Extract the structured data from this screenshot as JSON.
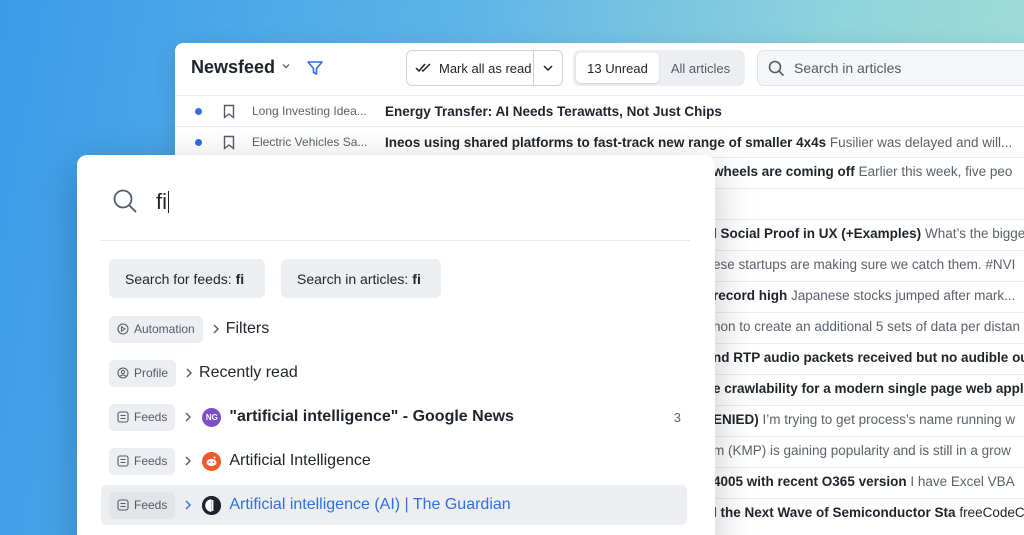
{
  "header": {
    "title": "Newsfeed",
    "mark_all_label": "Mark all as read",
    "tabs": [
      {
        "label": "13 Unread",
        "active": true
      },
      {
        "label": "All articles",
        "active": false
      }
    ],
    "search_placeholder": "Search in articles"
  },
  "articles": [
    {
      "unread": true,
      "source": "Long Investing Idea...",
      "title": "Energy Transfer: AI Needs Terawatts, Not Just Chips",
      "snippet": ""
    },
    {
      "unread": true,
      "source": "Electric Vehicles Sa...",
      "title": "Ineos using shared platforms to fast-track new range of smaller 4x4s",
      "snippet": "Fusilier was delayed and will..."
    }
  ],
  "partial_rows": [
    {
      "title": "wheels are coming off",
      "snippet": "Earlier this week, five peo"
    },
    {
      "title": "",
      "snippet": ""
    },
    {
      "title": "l Social Proof in UX (+Examples)",
      "snippet": "What’s the bigge"
    },
    {
      "title": "",
      "snippet": "ese startups are making sure we catch them. #NVI"
    },
    {
      "title": "record high",
      "snippet": "Japanese stocks jumped after mark..."
    },
    {
      "title": "",
      "snippet": "non to create an additional 5 sets of data per distan"
    },
    {
      "title": "nd RTP audio packets received but no audible ou",
      "snippet": ""
    },
    {
      "title": "e crawlability for a modern single page web appli",
      "snippet": ""
    },
    {
      "title": "ENIED)",
      "snippet": "I’m trying to get process’s name running w"
    },
    {
      "title": "",
      "snippet": "m (KMP) is gaining popularity and is still in a grow"
    },
    {
      "title": "4005 with recent O365 version",
      "snippet": "I have Excel VBA"
    },
    {
      "title": "l the Next Wave of Semiconductor Sta",
      "snippet": "",
      "tag": "freeCodeCa"
    }
  ],
  "palette": {
    "query": "fi",
    "actions": [
      {
        "prefix": "Search for feeds:",
        "term": "fi"
      },
      {
        "prefix": "Search in articles:",
        "term": "fi"
      }
    ],
    "results": [
      {
        "badge": "Automation",
        "badge_icon": "automation-icon",
        "label": "Filters",
        "style": "normal",
        "count": ""
      },
      {
        "badge": "Profile",
        "badge_icon": "profile-icon",
        "label": "Recently read",
        "style": "normal",
        "count": ""
      },
      {
        "badge": "Feeds",
        "badge_icon": "feeds-icon",
        "feed_icon": "NG",
        "feed_color": "#7b4fc9",
        "label": "\"artificial intelligence\" - Google News",
        "style": "bold",
        "count": "3"
      },
      {
        "badge": "Feeds",
        "badge_icon": "feeds-icon",
        "feed_icon": "reddit",
        "feed_color": "#ee5a2a",
        "label": "Artificial Intelligence",
        "style": "normal",
        "count": ""
      },
      {
        "badge": "Feeds",
        "badge_icon": "feeds-icon",
        "feed_icon": "guardian",
        "feed_color": "#1f232b",
        "label": "Artificial intelligence (AI) | The Guardian",
        "style": "link",
        "count": "",
        "selected": true
      }
    ]
  }
}
